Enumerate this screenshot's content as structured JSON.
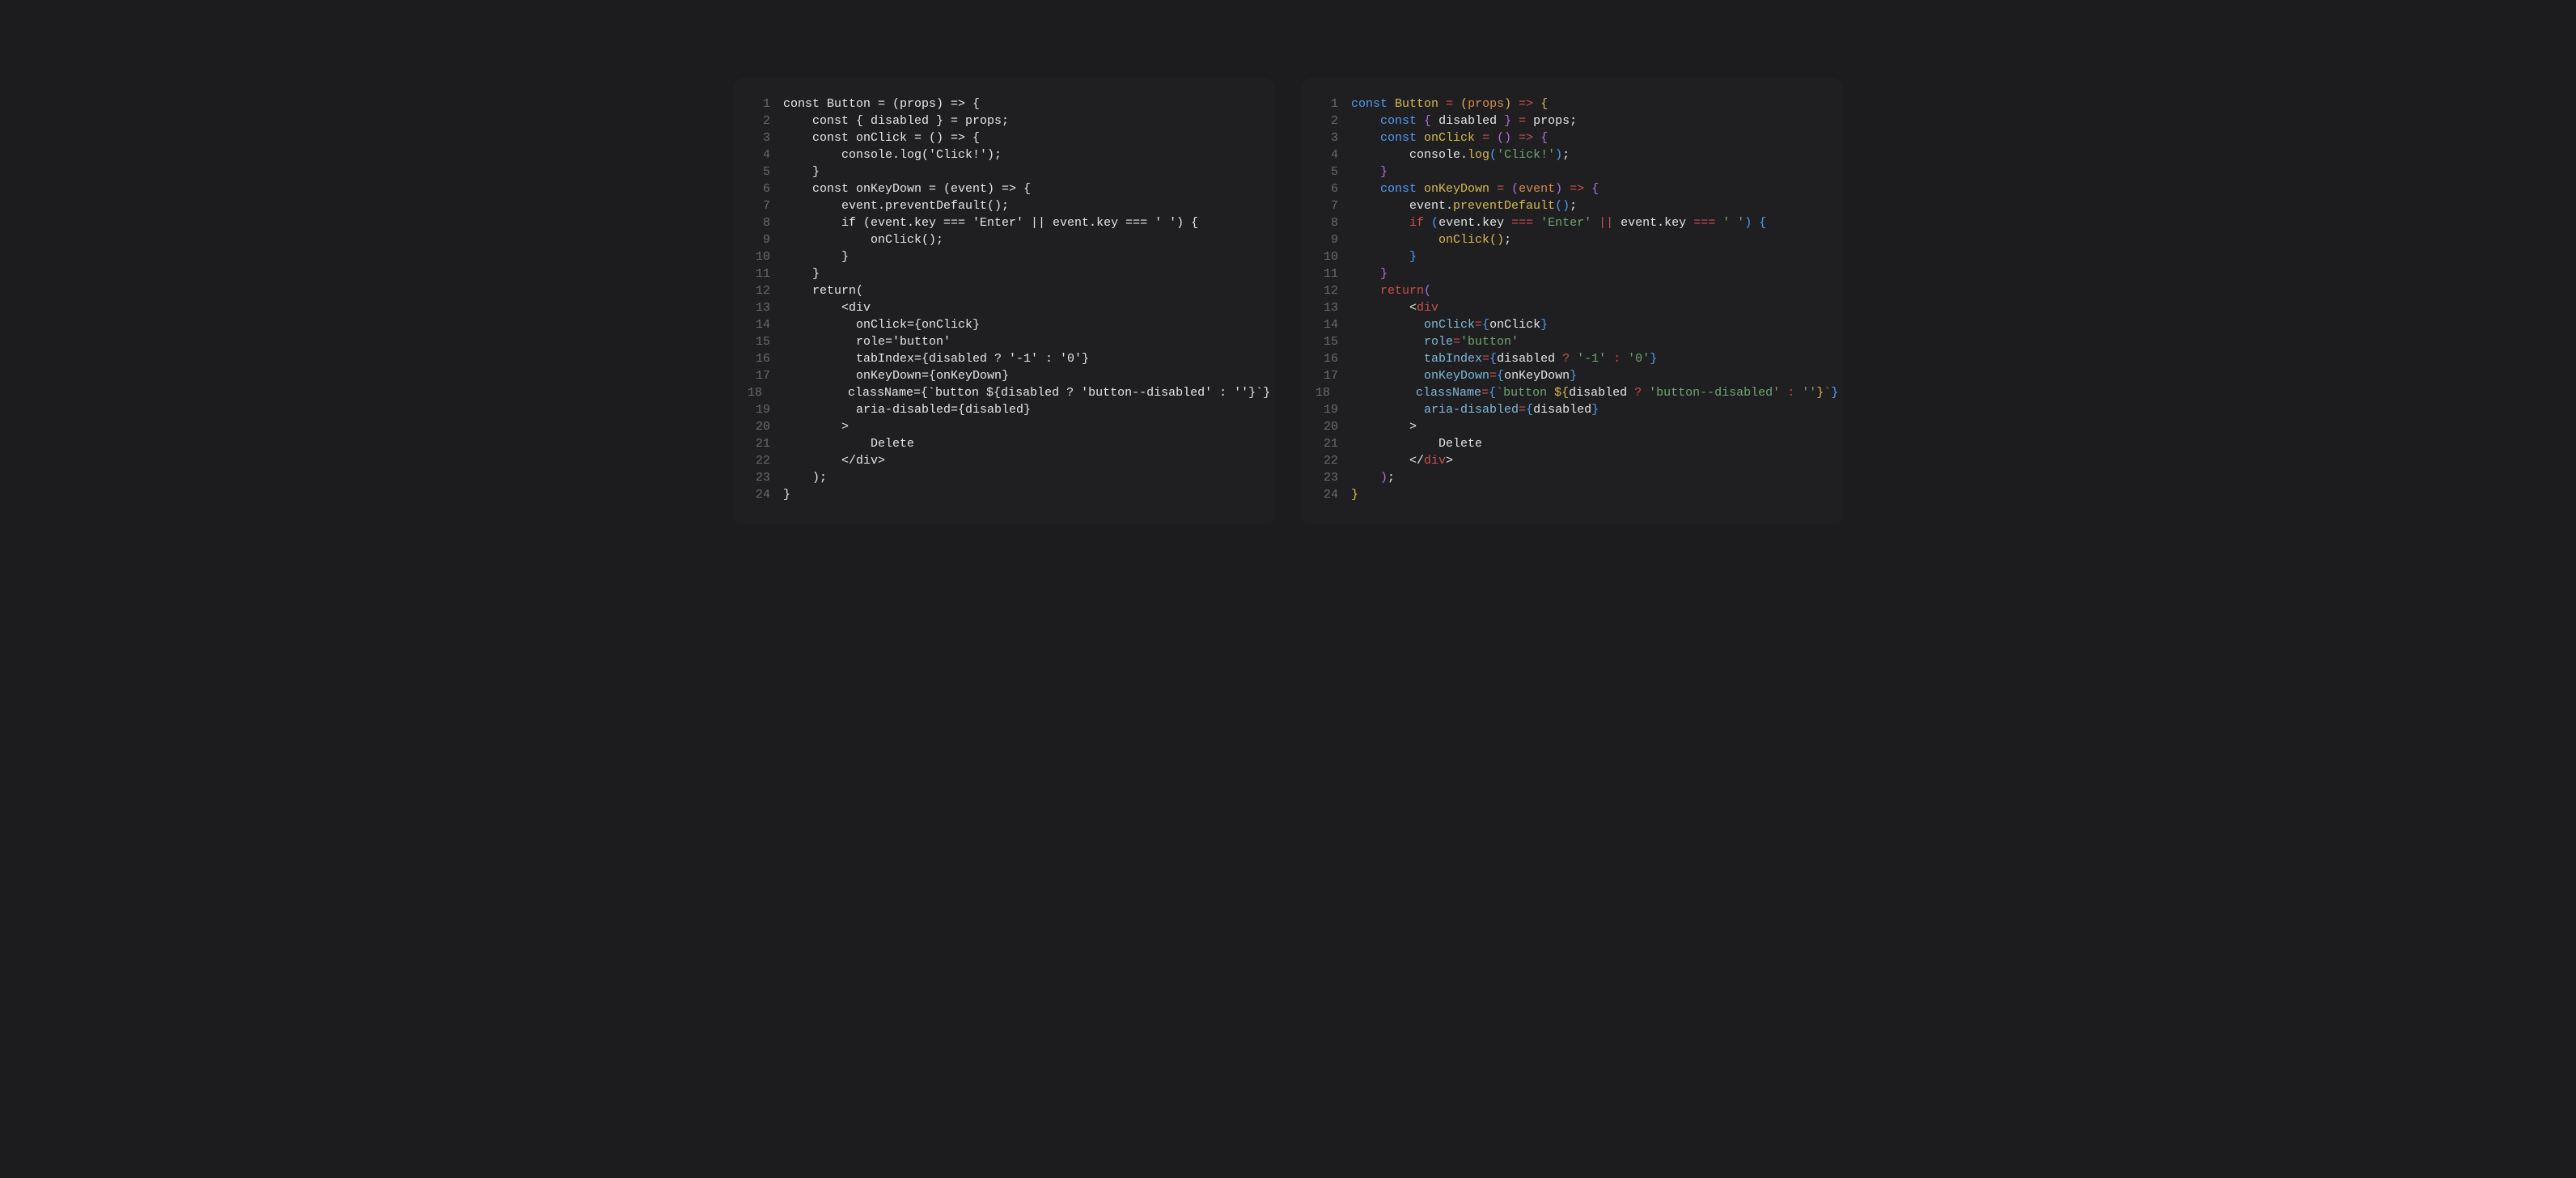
{
  "panels": [
    {
      "id": "plain",
      "highlight": false,
      "lines": [
        "const Button = (props) => {",
        "    const { disabled } = props;",
        "    const onClick = () => {",
        "        console.log('Click!');",
        "    }",
        "    const onKeyDown = (event) => {",
        "        event.preventDefault();",
        "        if (event.key === 'Enter' || event.key === ' ') {",
        "            onClick();",
        "        }",
        "    }",
        "    return(",
        "        <div",
        "          onClick={onClick}",
        "          role='button'",
        "          tabIndex={disabled ? '-1' : '0'}",
        "          onKeyDown={onKeyDown}",
        "          className={`button ${disabled ? 'button--disabled' : ''}`}",
        "          aria-disabled={disabled}",
        "        >",
        "            Delete",
        "        </div>",
        "    );",
        "}"
      ]
    },
    {
      "id": "highlighted",
      "highlight": true,
      "lines": [
        "const Button = (props) => {",
        "    const { disabled } = props;",
        "    const onClick = () => {",
        "        console.log('Click!');",
        "    }",
        "    const onKeyDown = (event) => {",
        "        event.preventDefault();",
        "        if (event.key === 'Enter' || event.key === ' ') {",
        "            onClick();",
        "        }",
        "    }",
        "    return(",
        "        <div",
        "          onClick={onClick}",
        "          role='button'",
        "          tabIndex={disabled ? '-1' : '0'}",
        "          onKeyDown={onKeyDown}",
        "          className={`button ${disabled ? 'button--disabled' : ''}`}",
        "          aria-disabled={disabled}",
        "        >",
        "            Delete",
        "        </div>",
        "    );",
        "}"
      ]
    }
  ]
}
